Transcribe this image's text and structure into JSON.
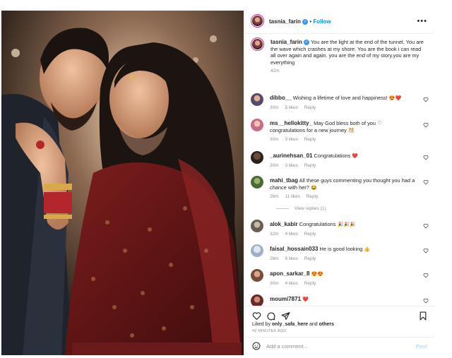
{
  "post": {
    "author": "tasnia_farin",
    "follow_label": "Follow",
    "more_label": "•••",
    "caption_author": "tasnia_farin",
    "caption_text": "You are the light at the end of the tunnel. You are the wave which crashes at my shore. You are the book i can read all over again and again. you are the end of my story.you are my everything",
    "caption_time": "42m"
  },
  "comments": [
    {
      "user": "dibbo__",
      "text": "Wishing a lifetime of love and happiness!",
      "emoji": "😍❤️",
      "time": "30m",
      "likes": "5 likes",
      "reply": "Reply"
    },
    {
      "user": "ms__hellokitty_",
      "text": "May God bless both of you ♡ congratulations for a new journey",
      "emoji": "🎊",
      "time": "30m",
      "likes": "3 likes",
      "reply": "Reply"
    },
    {
      "user": "_aurinehsan_01",
      "text": "Congratulations",
      "emoji": "❤️",
      "time": "30m",
      "likes": "3 likes",
      "reply": "Reply"
    },
    {
      "user": "mahi_tbag",
      "text": "All these guys commenting you thought you had a chance with her?",
      "emoji": "😂",
      "time": "26m",
      "likes": "11 likes",
      "reply": "Reply"
    },
    {
      "user": "alok_kabir",
      "text": "Congratulations",
      "emoji": "🎉🎉🎉",
      "time": "32m",
      "likes": "4 likes",
      "reply": "Reply"
    },
    {
      "user": "faisal_hossain033",
      "text": "He is good looking",
      "emoji": "👍",
      "time": "26m",
      "likes": "6 likes",
      "reply": "Reply"
    },
    {
      "user": "apon_sarkar_8",
      "text": "",
      "emoji": "😍😍",
      "time": "30m",
      "likes": "4 likes",
      "reply": "Reply"
    },
    {
      "user": "moumi7871",
      "text": "",
      "emoji": "❤️",
      "time": "",
      "likes": "",
      "reply": ""
    }
  ],
  "view_replies": "View replies (1)",
  "actions": {
    "liked_by_prefix": "Liked by",
    "liked_by_user": "only_safa_here",
    "liked_by_suffix": "and",
    "liked_by_others": "others",
    "time_ago": "42 MINUTES AGO"
  },
  "add_comment": {
    "placeholder": "Add a comment...",
    "post_label": "Post"
  },
  "colors": {
    "accent": "#0095f6",
    "heart": "#ed4956",
    "verified": "#3897f0",
    "story_ring": "#d6249f"
  },
  "icons": [
    "heart-icon",
    "comment-icon",
    "share-icon",
    "bookmark-icon",
    "emoji-icon",
    "more-icon"
  ]
}
